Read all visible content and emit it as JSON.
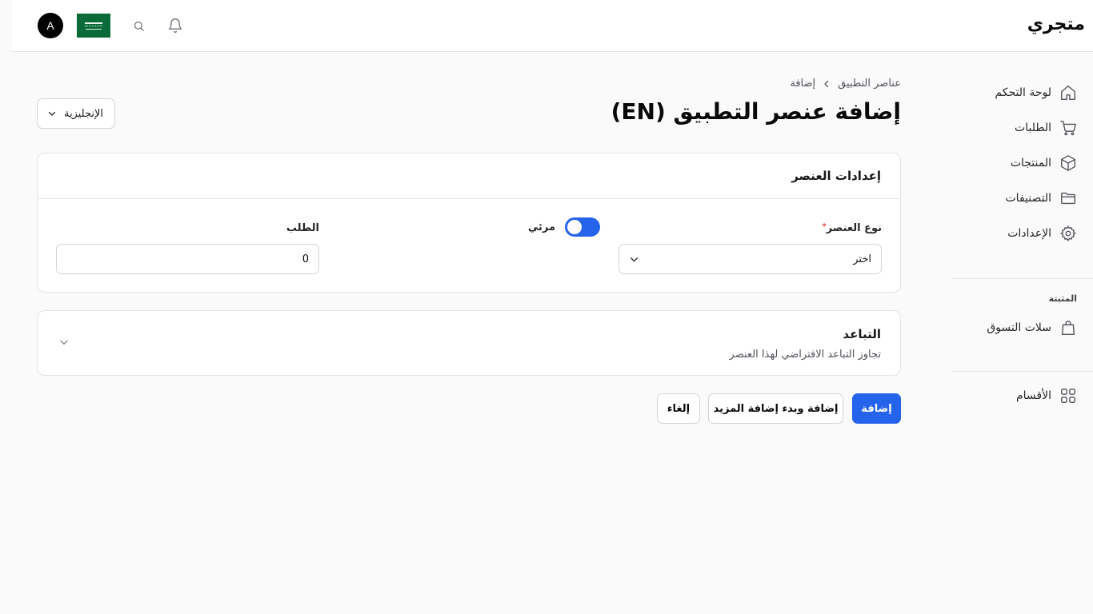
{
  "app": {
    "brand": "متجري"
  },
  "topbar": {
    "avatar_letter": "A"
  },
  "sidebar": {
    "items": [
      {
        "label": "لوحة التحكم",
        "icon": "home-icon"
      },
      {
        "label": "الطلبات",
        "icon": "cart-icon"
      },
      {
        "label": "المنتجات",
        "icon": "box-icon"
      },
      {
        "label": "التصنيفات",
        "icon": "folder-icon"
      },
      {
        "label": "الإعدادات",
        "icon": "gear-icon"
      }
    ],
    "pinned_section": "المثبتة",
    "pinned_items": [
      {
        "label": "سلات التسوق",
        "icon": "shopping-bag-icon"
      }
    ],
    "bottom_items": [
      {
        "label": "الأقسام",
        "icon": "grid-icon"
      }
    ]
  },
  "breadcrumb": {
    "parent": "عناصر التطبيق",
    "current": "إضافة"
  },
  "page": {
    "title": "إضافة عنصر التطبيق (EN)"
  },
  "language_select": {
    "value": "الإنجليزية"
  },
  "settings_card": {
    "title": "إعدادات العنصر",
    "type_label": "نوع العنصر",
    "type_required_mark": "*",
    "type_value": "اختر",
    "visible_label": "مرئي",
    "visible_on": true,
    "order_label": "الطلب",
    "order_value": "0"
  },
  "spacing_card": {
    "title": "التباعد",
    "description": "تجاوز التباعد الافتراضي لهذا العنصر"
  },
  "actions": {
    "add": "إضافة",
    "add_and_continue": "إضافة وبدء إضافة المزيد",
    "cancel": "إلغاء"
  },
  "colors": {
    "primary": "#2563eb",
    "flag_green": "#0a6b38"
  }
}
